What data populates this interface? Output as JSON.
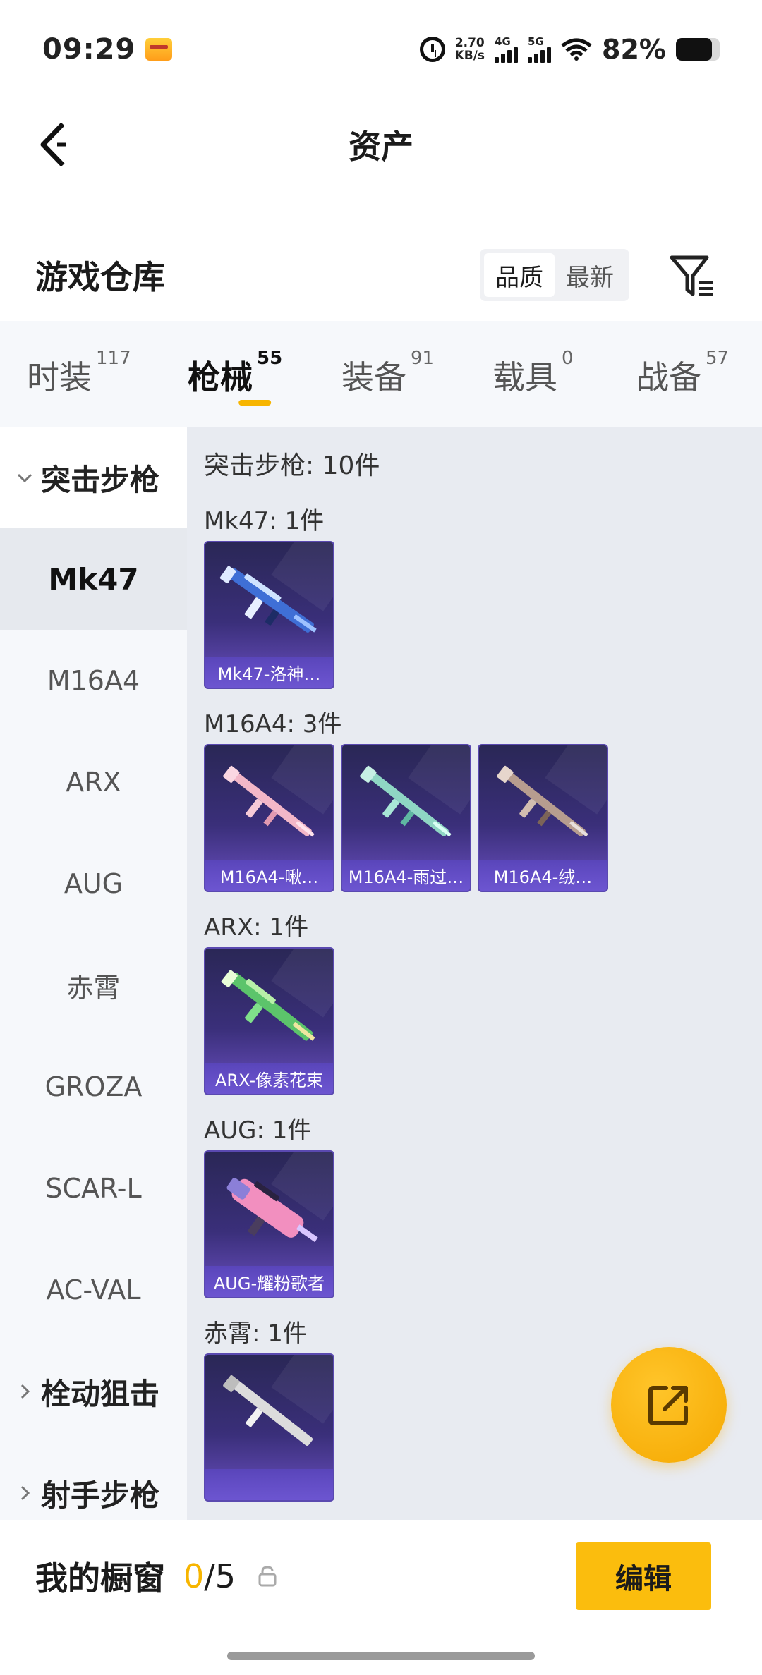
{
  "status_bar": {
    "time": "09:29",
    "speed_value": "2.70",
    "speed_unit": "KB/s",
    "net1": "4G",
    "net2": "5G",
    "battery": "82%",
    "battery_level": 0.82
  },
  "header": {
    "title": "资产"
  },
  "warehouse": {
    "title": "游戏仓库",
    "sort_options": [
      "品质",
      "最新"
    ],
    "active_sort": "品质"
  },
  "tabs": [
    {
      "label": "时装",
      "count": "117"
    },
    {
      "label": "枪械",
      "count": "55"
    },
    {
      "label": "装备",
      "count": "91"
    },
    {
      "label": "载具",
      "count": "0"
    },
    {
      "label": "战备",
      "count": "57"
    }
  ],
  "sidebar": {
    "group_open": "突击步枪",
    "items": [
      "Mk47",
      "M16A4",
      "ARX",
      "AUG",
      "赤霄",
      "GROZA",
      "SCAR-L",
      "AC-VAL"
    ],
    "active_item": "Mk47",
    "groups_closed": [
      "栓动狙击",
      "射手步枪"
    ]
  },
  "content": {
    "section_title": "突击步枪: 10件",
    "groups": [
      {
        "title": "Mk47: 1件",
        "cards": [
          "Mk47-洛神…"
        ]
      },
      {
        "title": "M16A4: 3件",
        "cards": [
          "M16A4-啾…",
          "M16A4-雨过…",
          "M16A4-绒…"
        ]
      },
      {
        "title": "ARX: 1件",
        "cards": [
          "ARX-像素花束"
        ]
      },
      {
        "title": "AUG: 1件",
        "cards": [
          "AUG-耀粉歌者"
        ]
      },
      {
        "title": "赤霄: 1件",
        "cards": [
          ""
        ]
      }
    ]
  },
  "bottom_bar": {
    "title": "我的橱窗",
    "current": "0",
    "total": "/5",
    "edit_label": "编辑"
  },
  "colors": {
    "accent": "#f7b500",
    "card_bg": "#3a2f7a",
    "content_bg": "#e8ebf1"
  }
}
